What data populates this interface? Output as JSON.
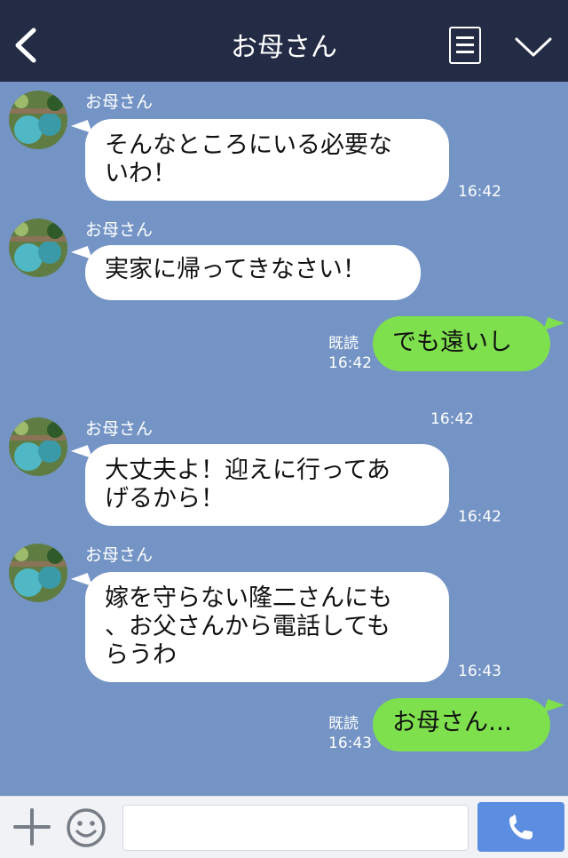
{
  "header": {
    "title": "お母さん",
    "icons": [
      "back-chevron-icon",
      "menu-icon",
      "collapse-chevron-icon"
    ]
  },
  "messages": [
    {
      "type": "in",
      "sender": "お母さん",
      "lines": [
        "そんなところにいる必要な",
        "いわ！"
      ],
      "time": "16:42"
    },
    {
      "type": "in",
      "sender": "お母さん",
      "lines": [
        "実家に帰ってきなさい！"
      ],
      "time": "16:42"
    },
    {
      "type": "out",
      "text": "でも遠いし",
      "read": "既読",
      "time": "16:42"
    },
    {
      "type": "in",
      "sender": "お母さん",
      "lines": [
        "大丈夫よ！迎えに行ってあ",
        "げるから！"
      ],
      "time": "16:42"
    },
    {
      "type": "in",
      "sender": "お母さん",
      "lines": [
        "嫁を守らない隆二さんにも",
        "、お父さんから電話しても",
        "らうわ"
      ],
      "time": "16:43"
    },
    {
      "type": "out",
      "text": "お母さん…",
      "read": "既読",
      "time": "16:43"
    }
  ],
  "footer": {
    "input_value": "",
    "icons": [
      "plus-icon",
      "emoji-icon",
      "phone-icon"
    ]
  },
  "colors": {
    "header_bg": "#232b45",
    "chat_bg": "#7494c5",
    "outgoing_bubble": "#7ee04d",
    "incoming_bubble": "#ffffff",
    "call_button": "#5b8de0"
  }
}
